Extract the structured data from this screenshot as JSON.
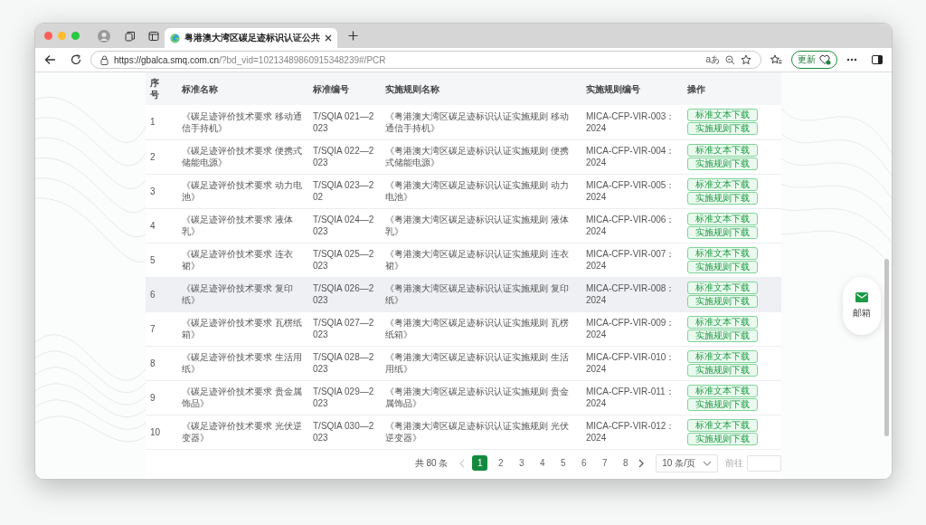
{
  "browser": {
    "tab": {
      "title": "粤港澳大湾区碳足迹标识认证公共"
    },
    "address": {
      "host": "https://gbalca.smq.com.cn",
      "path": "/?bd_vid=10213489860915348239#/PCR"
    },
    "read_aloud": "aあ",
    "update_button": "更新"
  },
  "table": {
    "columns": [
      "序号",
      "标准名称",
      "标准编号",
      "实施规则名称",
      "实施规则编号",
      "操作"
    ],
    "rows": [
      {
        "index": "1",
        "standard_name": "《碳足迹评价技术要求 移动通信手持机》",
        "standard_code": "T/SQIA 021—2023",
        "rule_name": "《粤港澳大湾区碳足迹标识认证实施规则 移动通信手持机》",
        "rule_code": "MICA-CFP-VIR-003：2024",
        "actions": [
          "标准文本下载",
          "实施规则下载"
        ],
        "highlighted": false
      },
      {
        "index": "2",
        "standard_name": "《碳足迹评价技术要求 便携式储能电源》",
        "standard_code": "T/SQIA 022—2023",
        "rule_name": "《粤港澳大湾区碳足迹标识认证实施规则 便携式储能电源》",
        "rule_code": "MICA-CFP-VIR-004：2024",
        "actions": [
          "标准文本下载",
          "实施规则下载"
        ],
        "highlighted": false
      },
      {
        "index": "3",
        "standard_name": "《碳足迹评价技术要求 动力电池》",
        "standard_code": "T/SQIA 023—202",
        "rule_name": "《粤港澳大湾区碳足迹标识认证实施规则 动力电池》",
        "rule_code": "MICA-CFP-VIR-005：2024",
        "actions": [
          "标准文本下载",
          "实施规则下载"
        ],
        "highlighted": false
      },
      {
        "index": "4",
        "standard_name": "《碳足迹评价技术要求 液体乳》",
        "standard_code": "T/SQIA 024—2023",
        "rule_name": "《粤港澳大湾区碳足迹标识认证实施规则 液体乳》",
        "rule_code": "MICA-CFP-VIR-006：2024",
        "actions": [
          "标准文本下载",
          "实施规则下载"
        ],
        "highlighted": false
      },
      {
        "index": "5",
        "standard_name": "《碳足迹评价技术要求 连衣裙》",
        "standard_code": "T/SQIA 025—2023",
        "rule_name": "《粤港澳大湾区碳足迹标识认证实施规则 连衣裙》",
        "rule_code": "MICA-CFP-VIR-007：2024",
        "actions": [
          "标准文本下载",
          "实施规则下载"
        ],
        "highlighted": false
      },
      {
        "index": "6",
        "standard_name": "《碳足迹评价技术要求 复印纸》",
        "standard_code": "T/SQIA 026—2023",
        "rule_name": "《粤港澳大湾区碳足迹标识认证实施规则 复印纸》",
        "rule_code": "MICA-CFP-VIR-008：2024",
        "actions": [
          "标准文本下载",
          "实施规则下载"
        ],
        "highlighted": true
      },
      {
        "index": "7",
        "standard_name": "《碳足迹评价技术要求 瓦楞纸箱》",
        "standard_code": "T/SQIA 027—2023",
        "rule_name": "《粤港澳大湾区碳足迹标识认证实施规则 瓦楞纸箱》",
        "rule_code": "MICA-CFP-VIR-009：2024",
        "actions": [
          "标准文本下载",
          "实施规则下载"
        ],
        "highlighted": false
      },
      {
        "index": "8",
        "standard_name": "《碳足迹评价技术要求 生活用纸》",
        "standard_code": "T/SQIA 028—2023",
        "rule_name": "《粤港澳大湾区碳足迹标识认证实施规则 生活用纸》",
        "rule_code": "MICA-CFP-VIR-010：2024",
        "actions": [
          "标准文本下载",
          "实施规则下载"
        ],
        "highlighted": false
      },
      {
        "index": "9",
        "standard_name": "《碳足迹评价技术要求 贵金属饰品》",
        "standard_code": "T/SQIA 029—2023",
        "rule_name": "《粤港澳大湾区碳足迹标识认证实施规则 贵金属饰品》",
        "rule_code": "MICA-CFP-VIR-011：2024",
        "actions": [
          "标准文本下载",
          "实施规则下载"
        ],
        "highlighted": false
      },
      {
        "index": "10",
        "standard_name": "《碳足迹评价技术要求 光伏逆变器》",
        "standard_code": "T/SQIA 030—2023",
        "rule_name": "《粤港澳大湾区碳足迹标识认证实施规则 光伏逆变器》",
        "rule_code": "MICA-CFP-VIR-012：2024",
        "actions": [
          "标准文本下载",
          "实施规则下载"
        ],
        "highlighted": false
      }
    ]
  },
  "pagination": {
    "total": "共 80 条",
    "pages": [
      {
        "label": "1",
        "selected": true
      },
      {
        "label": "2",
        "selected": false
      },
      {
        "label": "3",
        "selected": false
      },
      {
        "label": "4",
        "selected": false
      },
      {
        "label": "5",
        "selected": false
      },
      {
        "label": "6",
        "selected": false
      },
      {
        "label": "7",
        "selected": false
      },
      {
        "label": "8",
        "selected": false
      }
    ],
    "page_size": "10 条/页",
    "goto_label": "前往"
  },
  "floating_button": {
    "label": "邮箱"
  }
}
